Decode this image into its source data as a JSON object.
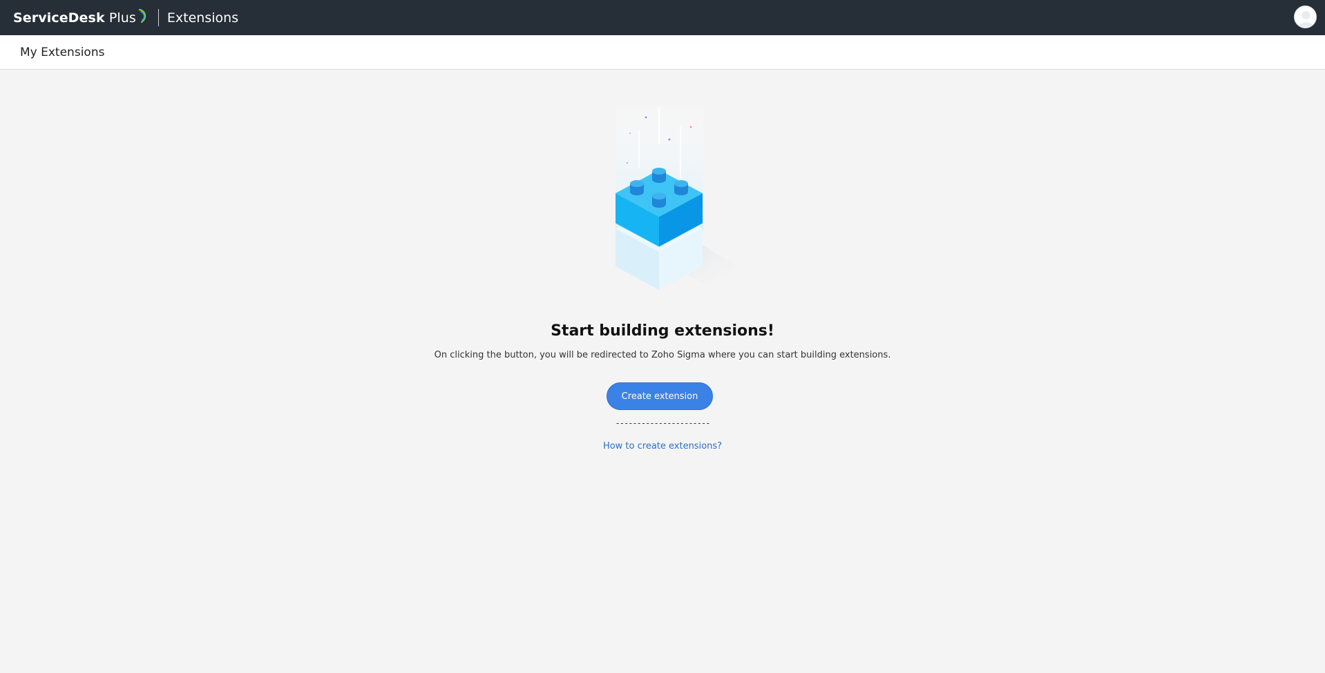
{
  "header": {
    "brand_primary": "ServiceDesk",
    "brand_secondary": "Plus",
    "module": "Extensions",
    "colors": {
      "bar": "#262e37",
      "swirl_green": "#8cc63f",
      "swirl_blue": "#29a8e0"
    }
  },
  "subheader": {
    "title": "My Extensions"
  },
  "empty_state": {
    "headline": "Start building extensions!",
    "description": "On clicking the button, you will be redirected to Zoho Sigma where you can start building extensions.",
    "primary_button": "Create extension",
    "separator": "----------------------",
    "help_link": "How to create extensions?",
    "illustration": "building-block-icon",
    "colors": {
      "button": "#3b82e6",
      "link": "#2a6fc9"
    }
  }
}
